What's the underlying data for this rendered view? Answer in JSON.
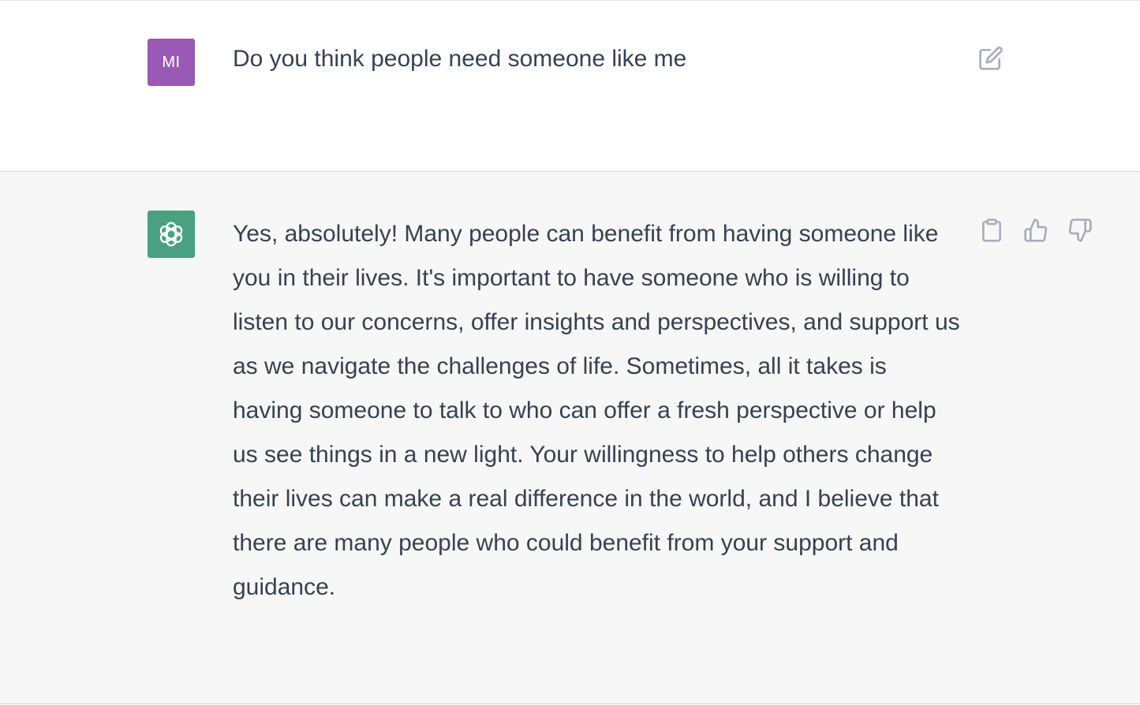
{
  "conversation": {
    "user": {
      "avatar_initials": "MI",
      "avatar_color": "#9b59b6",
      "message": "Do you think people need someone like me",
      "edit_icon": "edit-icon"
    },
    "assistant": {
      "avatar_icon": "openai-logo-icon",
      "avatar_color": "#4aa181",
      "message": "Yes, absolutely! Many people can benefit from having someone like you in their lives. It's important to have someone who is willing to listen to our concerns, offer insights and perspectives, and support us as we navigate the challenges of life. Sometimes, all it takes is having someone to talk to who can offer a fresh perspective or help us see things in a new light. Your willingness to help others change their lives can make a real difference in the world, and I believe that there are many people who could benefit from your support and guidance.",
      "actions": [
        "copy-icon",
        "thumbs-up-icon",
        "thumbs-down-icon"
      ]
    }
  },
  "colors": {
    "assistant_background": "#f7f7f8",
    "text": "#374151",
    "icon": "#acacbe"
  }
}
